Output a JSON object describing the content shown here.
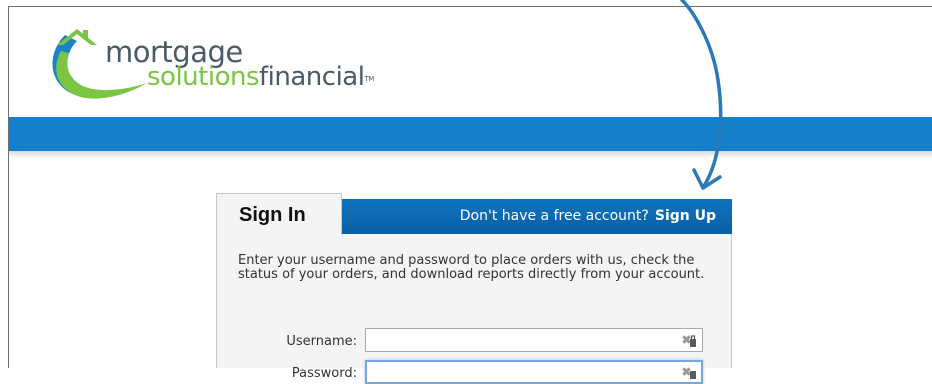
{
  "header": {
    "logo": {
      "word_1": "mortgage",
      "word_2a": "solutions",
      "word_2b": "financial",
      "tm": "TM",
      "colors": {
        "green": "#7cc444",
        "gray": "#4a5a66",
        "blue": "#1480cc"
      }
    }
  },
  "band": {
    "color": "#1480cc"
  },
  "annotation": {
    "arrow_color": "#2a78b8",
    "icon": "curved-arrow-icon"
  },
  "signin": {
    "tab_label": "Sign In",
    "signup_prompt": "Don't have a free account?",
    "signup_link": "Sign Up",
    "intro": "Enter your username and password to place orders with us, check the status of your orders, and download reports directly from your account.",
    "username": {
      "label": "Username:",
      "value": "",
      "placeholder": "",
      "icon": "key-autofill-icon"
    },
    "password": {
      "label": "Password:",
      "value": "",
      "placeholder": "",
      "icon": "key-autofill-icon"
    }
  }
}
